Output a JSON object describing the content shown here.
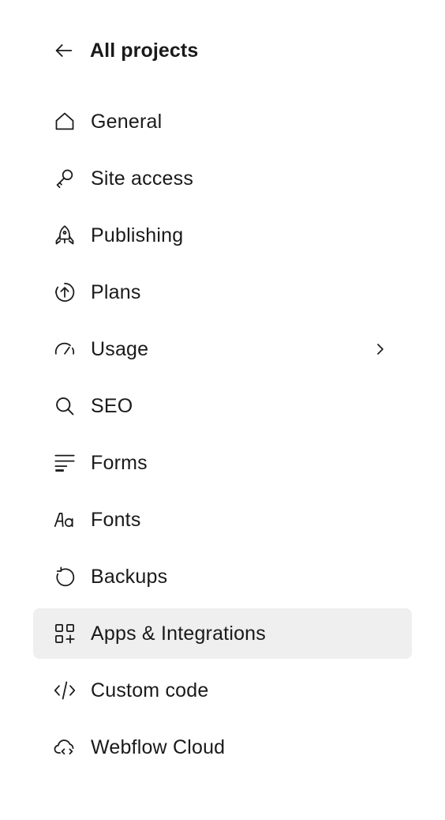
{
  "back": {
    "label": "All projects",
    "icon": "arrow-left-icon"
  },
  "nav": {
    "items": [
      {
        "label": "General",
        "icon": "home-icon",
        "active": false
      },
      {
        "label": "Site access",
        "icon": "key-icon",
        "active": false
      },
      {
        "label": "Publishing",
        "icon": "rocket-icon",
        "active": false
      },
      {
        "label": "Plans",
        "icon": "upgrade-circle-icon",
        "active": false
      },
      {
        "label": "Usage",
        "icon": "gauge-icon",
        "active": false,
        "has_submenu": true
      },
      {
        "label": "SEO",
        "icon": "search-icon",
        "active": false
      },
      {
        "label": "Forms",
        "icon": "form-lines-icon",
        "active": false
      },
      {
        "label": "Fonts",
        "icon": "font-aa-icon",
        "active": false
      },
      {
        "label": "Backups",
        "icon": "restore-icon",
        "active": false
      },
      {
        "label": "Apps & Integrations",
        "icon": "apps-add-icon",
        "active": true
      },
      {
        "label": "Custom code",
        "icon": "code-icon",
        "active": false
      },
      {
        "label": "Webflow Cloud",
        "icon": "cloud-code-icon",
        "active": false
      }
    ]
  },
  "colors": {
    "text": "#1a1a1a",
    "active_bg": "#efefef",
    "background": "#ffffff"
  }
}
